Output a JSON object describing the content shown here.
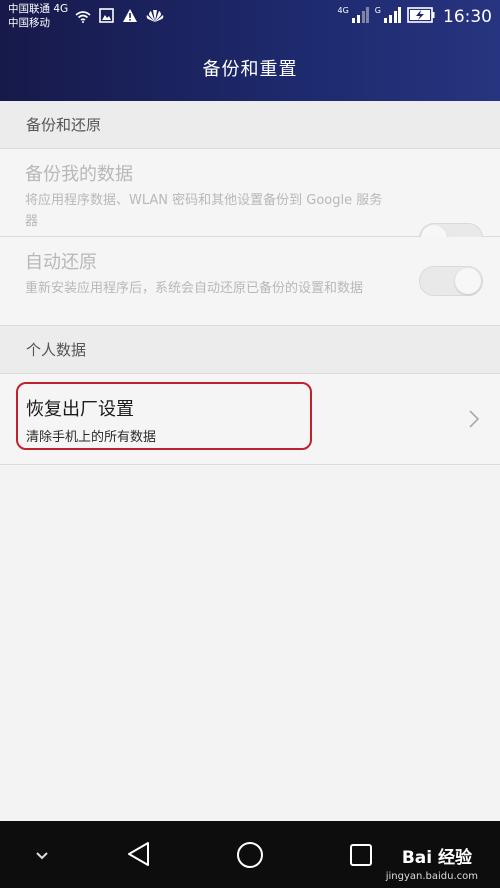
{
  "status_bar": {
    "carrier1": "中国联通 4G",
    "carrier2": "中国移动",
    "net1": "4G",
    "net2": "G",
    "time": "16:30"
  },
  "header": {
    "title": "备份和重置"
  },
  "backup_section": {
    "header": "备份和还原",
    "backup_data": {
      "title": "备份我的数据",
      "subtitle": "将应用程序数据、WLAN 密码和其他设置备份到 Google 服务器",
      "toggle_on": false
    },
    "auto_restore": {
      "title": "自动还原",
      "subtitle": "重新安装应用程序后，系统会自动还原已备份的设置和数据",
      "toggle_on": true
    }
  },
  "personal_section": {
    "header": "个人数据",
    "factory_reset": {
      "title": "恢复出厂设置",
      "subtitle": "清除手机上的所有数据"
    }
  },
  "watermark": {
    "brand": "Bai  经验",
    "url": "jingyan.baidu.com"
  },
  "colors": {
    "header_bg": "#1e2a6e",
    "highlight_border": "#c0222c",
    "disabled_text": "#b8b8b8"
  }
}
